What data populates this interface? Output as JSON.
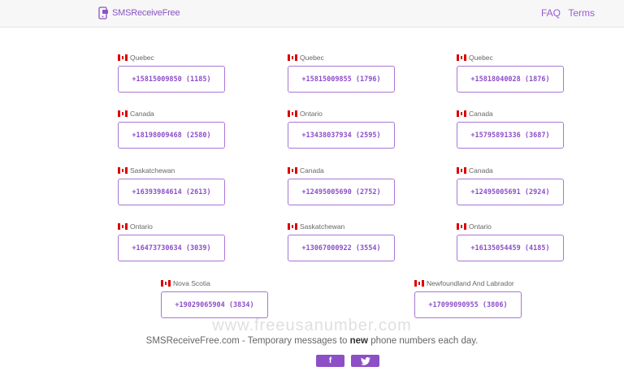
{
  "header": {
    "brand": "SMSReceiveFree",
    "nav": [
      {
        "label": "FAQ"
      },
      {
        "label": "Terms"
      }
    ]
  },
  "numbers": [
    {
      "region": "Quebec",
      "number": "+15815009850 (1185)"
    },
    {
      "region": "Quebec",
      "number": "+15815009855 (1796)"
    },
    {
      "region": "Quebec",
      "number": "+15818040028 (1876)"
    },
    {
      "region": "Canada",
      "number": "+18198009468 (2580)"
    },
    {
      "region": "Ontario",
      "number": "+13438037934 (2595)"
    },
    {
      "region": "Canada",
      "number": "+15795891336 (3687)"
    },
    {
      "region": "Saskatchewan",
      "number": "+16393984614 (2613)"
    },
    {
      "region": "Canada",
      "number": "+12495005690 (2752)"
    },
    {
      "region": "Canada",
      "number": "+12495005691 (2924)"
    },
    {
      "region": "Ontario",
      "number": "+16473730634 (3039)"
    },
    {
      "region": "Saskatchewan",
      "number": "+13067000922 (3554)"
    },
    {
      "region": "Ontario",
      "number": "+16135054459 (4185)"
    },
    {
      "region": "Nova Scotia",
      "number": "+19029065904 (3834)"
    },
    {
      "region": "Newfoundland And Labrador",
      "number": "+17099090955 (3806)"
    }
  ],
  "watermark": "www.freeusanumber.com",
  "footer": {
    "tagline_start": "SMSReceiveFree.com - Temporary messages to ",
    "tagline_bold": "new",
    "tagline_end": " phone numbers each day.",
    "facebook": "f",
    "twitter_icon": "twitter-icon"
  },
  "colors": {
    "accent": "#8d4fc6",
    "border": "#a776d6"
  }
}
